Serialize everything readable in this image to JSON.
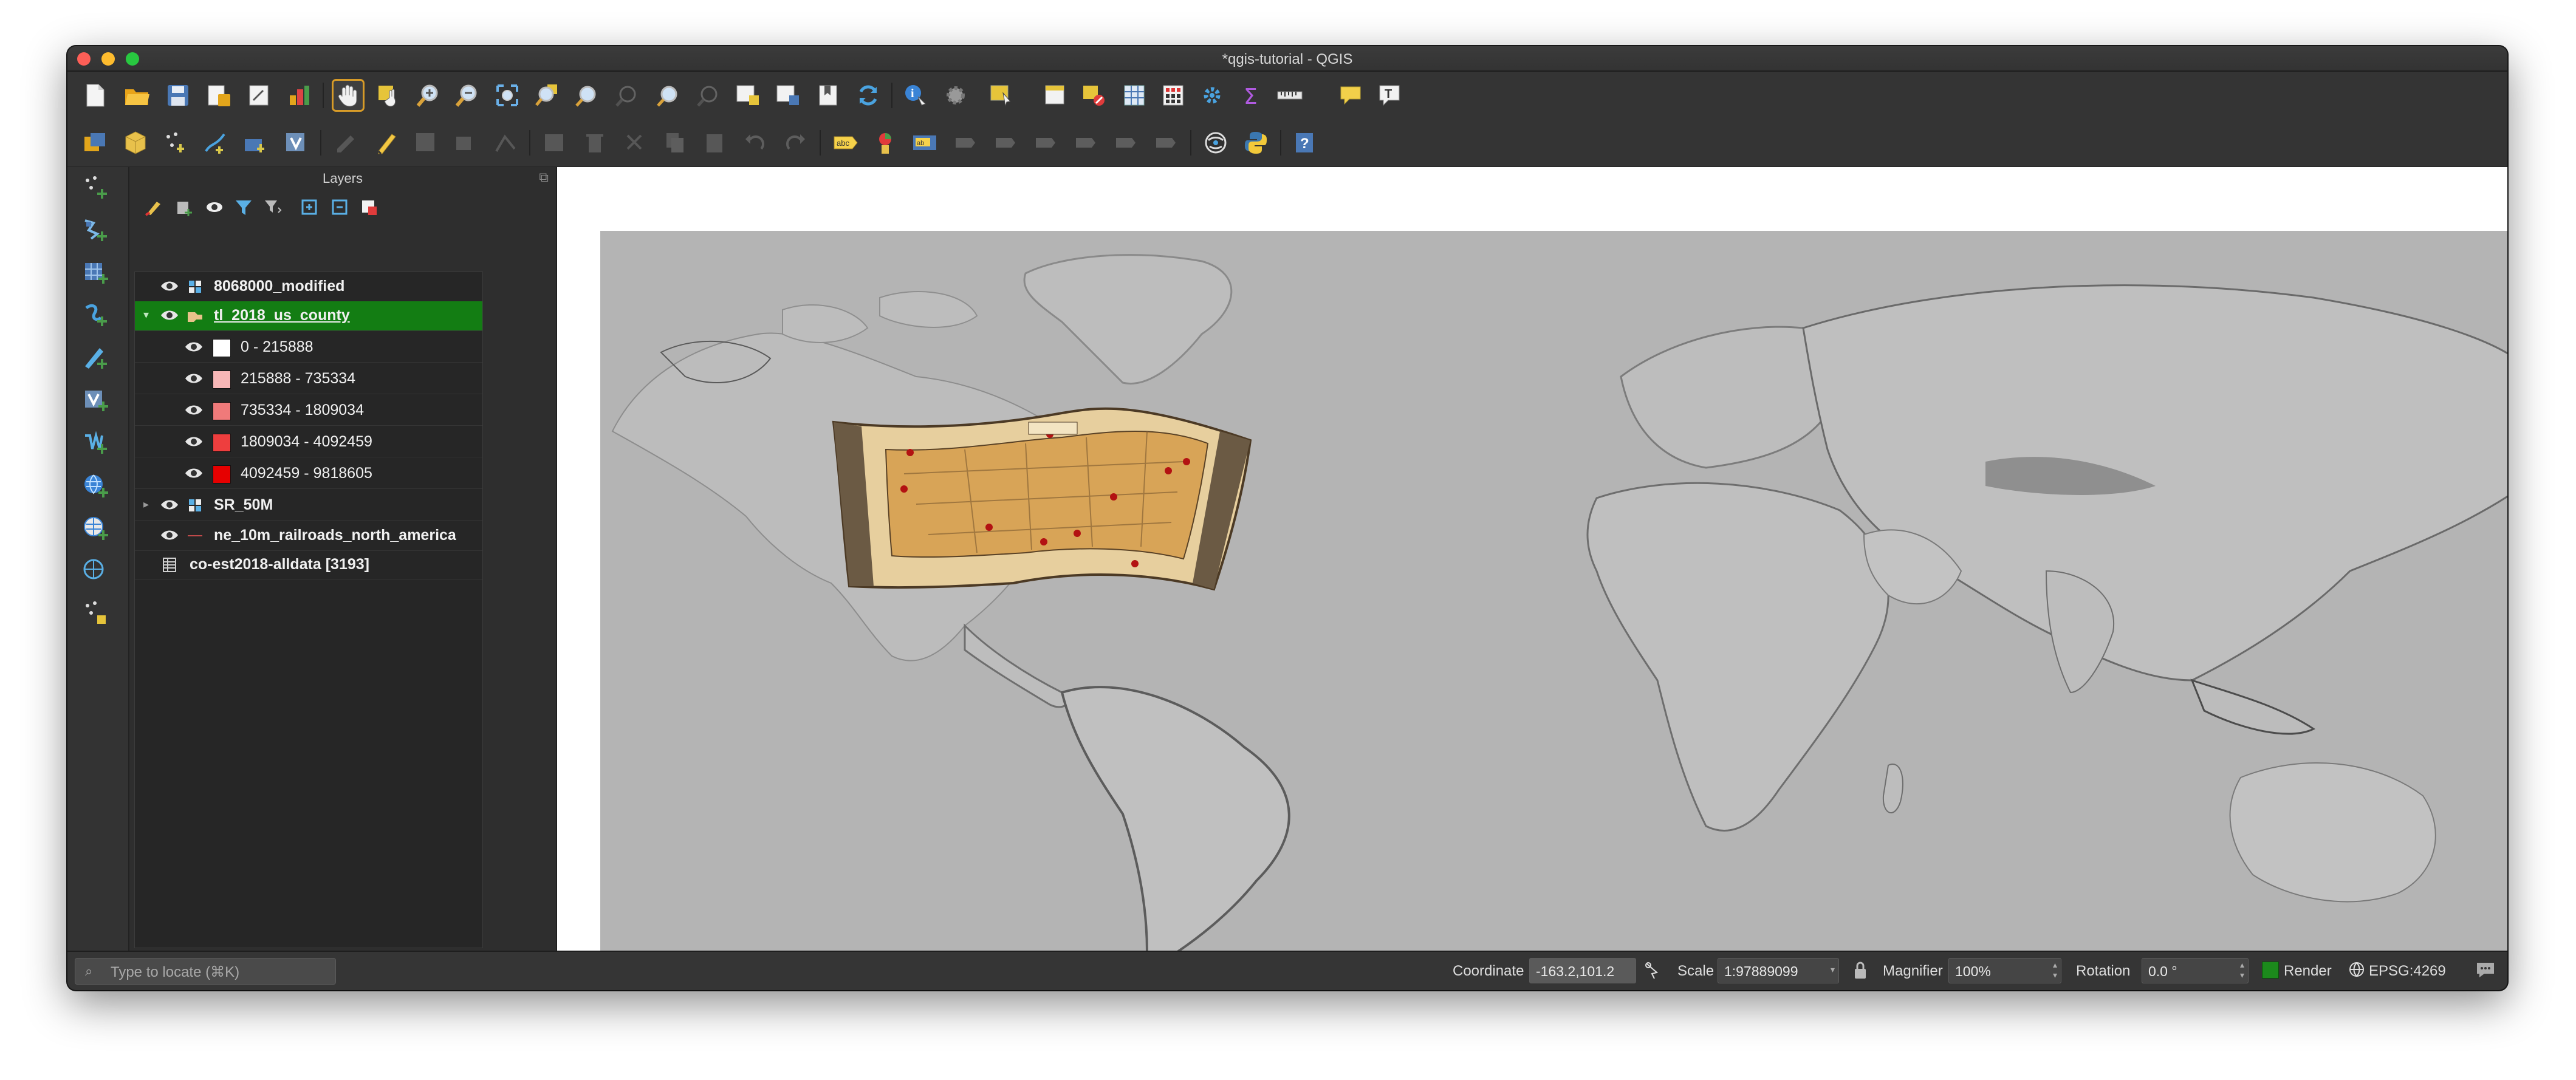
{
  "window": {
    "title": "*qgis-tutorial - QGIS"
  },
  "layers_panel": {
    "title": "Layers",
    "layers": [
      {
        "name": "8068000_modified",
        "visible": true,
        "type": "raster",
        "bold": true
      },
      {
        "name": "tl_2018_us_county",
        "visible": true,
        "type": "polygon",
        "bold": true,
        "selected": true,
        "expanded": true,
        "classes": [
          {
            "label": "0 - 215888",
            "color": "#ffffff"
          },
          {
            "label": "215888 - 735334",
            "color": "#f7b6b6"
          },
          {
            "label": "735334 - 1809034",
            "color": "#f07a7a"
          },
          {
            "label": "1809034 - 4092459",
            "color": "#ee3e3e"
          },
          {
            "label": "4092459 - 9818605",
            "color": "#e60000"
          }
        ]
      },
      {
        "name": "SR_50M",
        "visible": true,
        "type": "raster",
        "bold": true
      },
      {
        "name": "ne_10m_railroads_north_america",
        "visible": true,
        "type": "line",
        "bold": true
      },
      {
        "name": "co-est2018-alldata [3193]",
        "visible": false,
        "type": "table",
        "bold": true
      }
    ]
  },
  "statusbar": {
    "locate_placeholder": "Type to locate (⌘K)",
    "coordinate_label": "Coordinate",
    "coordinate_value": "-163.2,101.2",
    "scale_label": "Scale",
    "scale_value": "1:97889099",
    "magnifier_label": "Magnifier",
    "magnifier_value": "100%",
    "rotation_label": "Rotation",
    "rotation_value": "0.0 °",
    "render_label": "Render",
    "render_checked": true,
    "crs_label": "EPSG:4269"
  },
  "colors": {
    "selected_layer": "#137d13",
    "map_background": "#b4b4b4",
    "accent_active_tool": "#d79b28"
  }
}
